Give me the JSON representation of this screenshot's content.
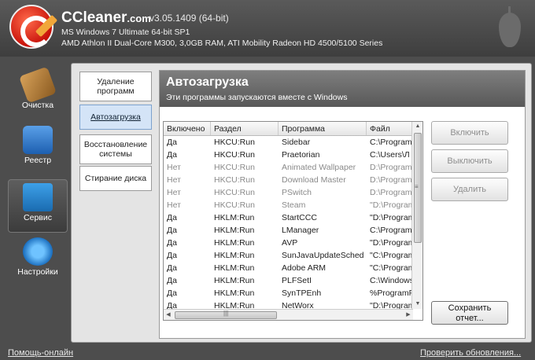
{
  "header": {
    "app_name": "CCleaner",
    "app_domain": ".com",
    "version": "v3.05.1409 (64-bit)",
    "os_line": "MS Windows 7 Ultimate 64-bit SP1",
    "hw_line": "AMD Athlon II Dual-Core M300, 3,0GB RAM, ATI Mobility Radeon HD 4500/5100 Series"
  },
  "nav": {
    "items": [
      {
        "label": "Очистка",
        "icon": "broom-icon"
      },
      {
        "label": "Реестр",
        "icon": "registry-cubes-icon"
      },
      {
        "label": "Сервис",
        "icon": "toolbox-icon"
      },
      {
        "label": "Настройки",
        "icon": "gear-icon"
      }
    ],
    "active": "Сервис"
  },
  "tools_menu": {
    "items": [
      "Удаление программ",
      "Автозагрузка",
      "Восстановление системы",
      "Стирание диска"
    ],
    "active": "Автозагрузка"
  },
  "content": {
    "title": "Автозагрузка",
    "subtitle": "Эти программы запускаются вместе с Windows"
  },
  "table": {
    "columns": [
      "Включено",
      "Раздел",
      "Программа",
      "Файл"
    ],
    "rows": [
      {
        "enabled": "Да",
        "section": "HKCU:Run",
        "program": "Sidebar",
        "file": "C:\\Program",
        "active": true
      },
      {
        "enabled": "Да",
        "section": "HKCU:Run",
        "program": "Praetorian",
        "file": "C:\\Users\\Л",
        "active": true
      },
      {
        "enabled": "Нет",
        "section": "HKCU:Run",
        "program": "Animated Wallpaper",
        "file": "D:\\Program",
        "active": false
      },
      {
        "enabled": "Нет",
        "section": "HKCU:Run",
        "program": "Download Master",
        "file": "D:\\Program",
        "active": false
      },
      {
        "enabled": "Нет",
        "section": "HKCU:Run",
        "program": "PSwitch",
        "file": "D:\\Program",
        "active": false
      },
      {
        "enabled": "Нет",
        "section": "HKCU:Run",
        "program": "Steam",
        "file": "\"D:\\Program",
        "active": false
      },
      {
        "enabled": "Да",
        "section": "HKLM:Run",
        "program": "StartCCC",
        "file": "\"D:\\Program",
        "active": true
      },
      {
        "enabled": "Да",
        "section": "HKLM:Run",
        "program": "LManager",
        "file": "C:\\Program",
        "active": true
      },
      {
        "enabled": "Да",
        "section": "HKLM:Run",
        "program": "AVP",
        "file": "\"D:\\Program",
        "active": true
      },
      {
        "enabled": "Да",
        "section": "HKLM:Run",
        "program": "SunJavaUpdateSched",
        "file": "\"C:\\Program",
        "active": true
      },
      {
        "enabled": "Да",
        "section": "HKLM:Run",
        "program": "Adobe ARM",
        "file": "\"C:\\Program",
        "active": true
      },
      {
        "enabled": "Да",
        "section": "HKLM:Run",
        "program": "PLFSetI",
        "file": "C:\\Windows",
        "active": true
      },
      {
        "enabled": "Да",
        "section": "HKLM:Run",
        "program": "SynTPEnh",
        "file": "%ProgramF",
        "active": true
      },
      {
        "enabled": "Да",
        "section": "HKLM:Run",
        "program": "NetWorx",
        "file": "\"D:\\Program",
        "active": true
      }
    ]
  },
  "buttons": {
    "enable": "Включить",
    "disable": "Выключить",
    "delete": "Удалить",
    "save_line1": "Сохранить",
    "save_line2": "отчет..."
  },
  "footer": {
    "help": "Помощь-онлайн",
    "updates": "Проверить обновления..."
  }
}
